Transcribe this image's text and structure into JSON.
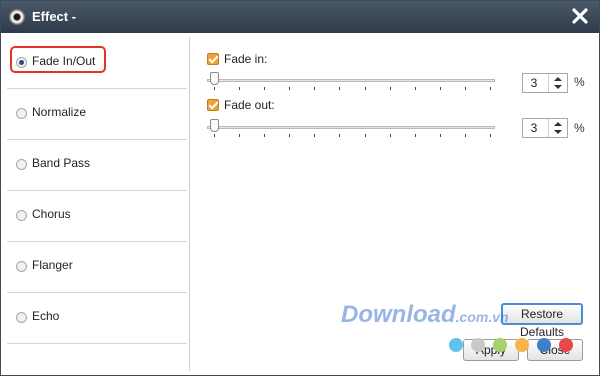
{
  "window": {
    "title": "Effect -"
  },
  "sidebar": {
    "items": [
      {
        "label": "Fade In/Out",
        "selected": true
      },
      {
        "label": "Normalize",
        "selected": false
      },
      {
        "label": "Band Pass",
        "selected": false
      },
      {
        "label": "Chorus",
        "selected": false
      },
      {
        "label": "Flanger",
        "selected": false
      },
      {
        "label": "Echo",
        "selected": false
      }
    ]
  },
  "fade": {
    "fade_in": {
      "label": "Fade in:",
      "checked": true,
      "value": "3",
      "unit": "%"
    },
    "fade_out": {
      "label": "Fade out:",
      "checked": true,
      "value": "3",
      "unit": "%"
    }
  },
  "buttons": {
    "restore": "Restore Defaults",
    "apply": "Apply",
    "close": "Close"
  },
  "watermark": {
    "brand": "Download",
    "domain": ".com.vn"
  },
  "colors": {
    "titlebar": "#3a4656",
    "checkbox": "#f0a23a",
    "highlight": "#e2322a",
    "watermark": "#4678d2",
    "dots": [
      "#5fc3ee",
      "#c8c8c8",
      "#a7d26a",
      "#f6b54a",
      "#3f7fc9",
      "#e8484a"
    ]
  }
}
